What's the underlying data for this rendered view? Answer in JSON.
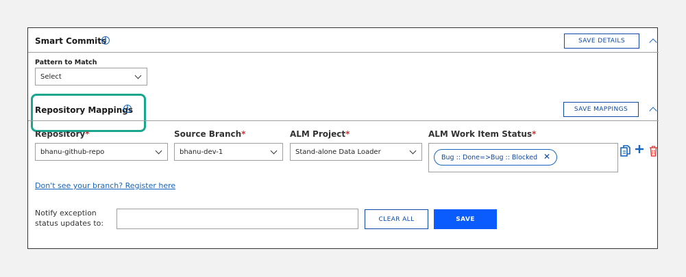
{
  "smart_commits": {
    "title": "Smart Commits",
    "save_label": "SAVE DETAILS",
    "pattern_label": "Pattern to Match",
    "pattern_value": "Select"
  },
  "repo_mappings": {
    "title": "Repository Mappings",
    "save_label": "SAVE MAPPINGS",
    "columns": {
      "repository": "Repository",
      "source_branch": "Source Branch",
      "alm_project": "ALM Project",
      "alm_status": "ALM Work Item Status",
      "required_marker": "*"
    },
    "row": {
      "repository": "bhanu-github-repo",
      "source_branch": "bhanu-dev-1",
      "alm_project": "Stand-alone Data Loader",
      "status_chip": "Bug :: Done=>Bug :: Blocked"
    },
    "register_link": "Don't see your branch? Register here"
  },
  "notify": {
    "label_line1": "Notify exception",
    "label_line2": "status updates to:",
    "value": "",
    "clear_label": "CLEAR ALL",
    "save_label": "SAVE"
  },
  "colors": {
    "accent": "#0a5cff",
    "link": "#1565c0",
    "required": "#d32f2f",
    "highlight": "#1aa58f",
    "delete": "#e53935"
  }
}
